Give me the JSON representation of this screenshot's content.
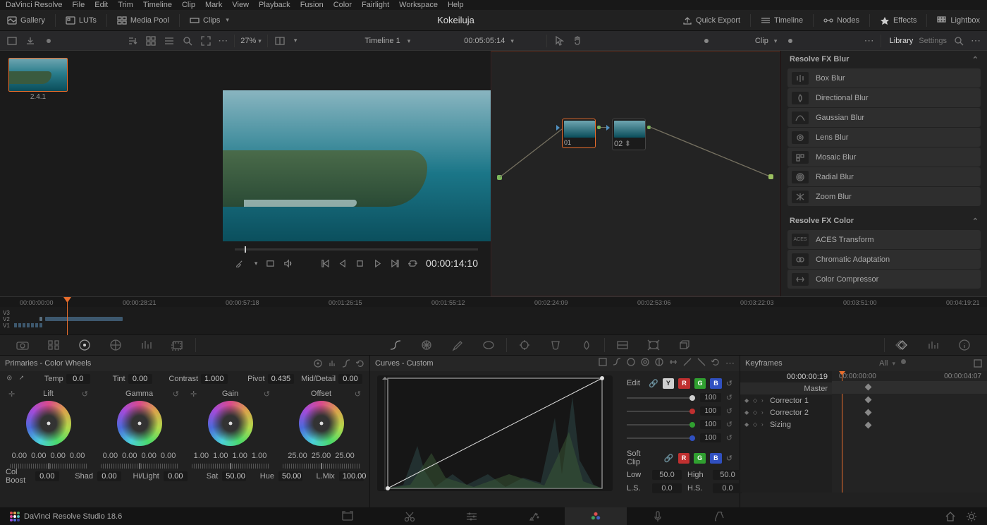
{
  "menubar": [
    "DaVinci Resolve",
    "File",
    "Edit",
    "Trim",
    "Timeline",
    "Clip",
    "Mark",
    "View",
    "Playback",
    "Fusion",
    "Color",
    "Fairlight",
    "Workspace",
    "Help"
  ],
  "toolbar2": {
    "gallery": "Gallery",
    "luts": "LUTs",
    "mediapool": "Media Pool",
    "clips": "Clips",
    "quickexport": "Quick Export",
    "timeline": "Timeline",
    "nodes": "Nodes",
    "effects": "Effects",
    "lightbox": "Lightbox"
  },
  "toolbar3": {
    "zoom": "27%",
    "timeline_label": "Timeline 1",
    "src_tc": "00:05:05:14",
    "clip_label": "Clip"
  },
  "project_title": "Kokeiluja",
  "gallery": {
    "thumb_caption": "2.4.1"
  },
  "viewer": {
    "timecode": "00:00:14:10"
  },
  "nodes": {
    "n1": "01",
    "n2": "02"
  },
  "fx": {
    "tabs": [
      "Library",
      "Settings"
    ],
    "cat_blur": "Resolve FX Blur",
    "blur_list": [
      "Box Blur",
      "Directional Blur",
      "Gaussian Blur",
      "Lens Blur",
      "Mosaic Blur",
      "Radial Blur",
      "Zoom Blur"
    ],
    "cat_color": "Resolve FX Color",
    "color_list": [
      "ACES Transform",
      "Chromatic Adaptation",
      "Color Compressor"
    ]
  },
  "timeline": {
    "ticks": [
      "00:00:00:00",
      "00:00:28:21",
      "00:00:57:18",
      "00:01:26:15",
      "00:01:55:12",
      "00:02:24:09",
      "00:02:53:06",
      "00:03:22:03",
      "00:03:51:00",
      "00:04:19:21"
    ],
    "tracks": [
      "V3",
      "V2",
      "V1"
    ]
  },
  "primaries": {
    "title": "Primaries - Color Wheels",
    "temp_label": "Temp",
    "temp_val": "0.0",
    "tint_label": "Tint",
    "tint_val": "0.00",
    "contrast_label": "Contrast",
    "contrast_val": "1.000",
    "pivot_label": "Pivot",
    "pivot_val": "0.435",
    "md_label": "Mid/Detail",
    "md_val": "0.00",
    "wheels": [
      {
        "name": "Lift",
        "vals": [
          "0.00",
          "0.00",
          "0.00",
          "0.00"
        ]
      },
      {
        "name": "Gamma",
        "vals": [
          "0.00",
          "0.00",
          "0.00",
          "0.00"
        ]
      },
      {
        "name": "Gain",
        "vals": [
          "1.00",
          "1.00",
          "1.00",
          "1.00"
        ]
      },
      {
        "name": "Offset",
        "vals": [
          "25.00",
          "25.00",
          "25.00"
        ]
      }
    ],
    "bottom": {
      "colboost": "Col Boost",
      "colboost_v": "0.00",
      "shad": "Shad",
      "shad_v": "0.00",
      "hilight": "Hi/Light",
      "hilight_v": "0.00",
      "sat": "Sat",
      "sat_v": "50.00",
      "hue": "Hue",
      "hue_v": "50.00",
      "lmix": "L.Mix",
      "lmix_v": "100.00"
    }
  },
  "curves": {
    "title": "Curves - Custom",
    "edit_label": "Edit",
    "channels": [
      "Y",
      "R",
      "G",
      "B"
    ],
    "ch_vals": [
      "100",
      "100",
      "100",
      "100"
    ],
    "softclip": "Soft Clip",
    "low": "Low",
    "low_v": "50.0",
    "high": "High",
    "high_v": "50.0",
    "ls": "L.S.",
    "ls_v": "0.0",
    "hs": "H.S.",
    "hs_v": "0.0"
  },
  "keyframes": {
    "title": "Keyframes",
    "all": "All",
    "src_tc": "00:00:00:19",
    "ruler_l": "00:00:00:00",
    "ruler_r": "00:00:04:07",
    "rows": [
      "Master",
      "Corrector 1",
      "Corrector 2",
      "Sizing"
    ]
  },
  "pagebar": {
    "app": "DaVinci Resolve Studio 18.6"
  }
}
